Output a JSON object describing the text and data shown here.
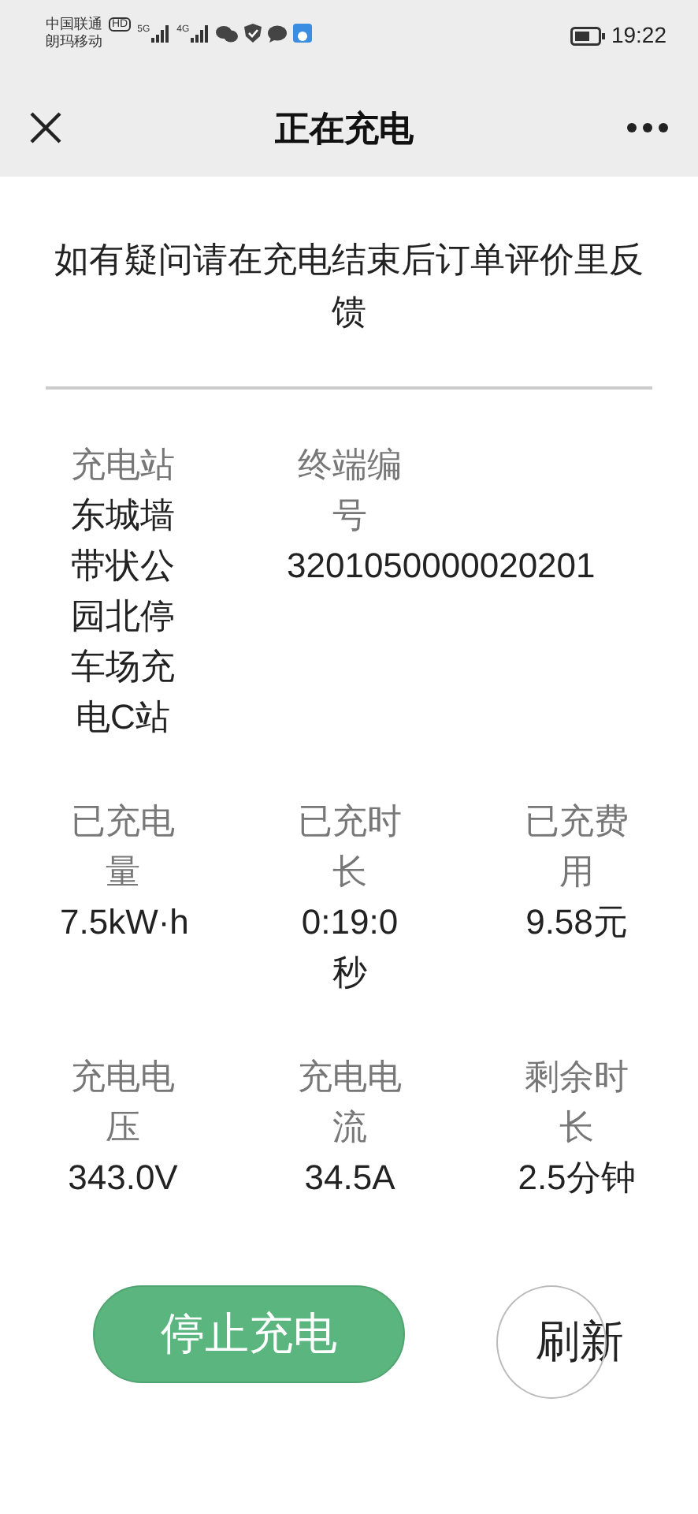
{
  "status_bar": {
    "carrier_1": "中国联通",
    "hd": "HD",
    "carrier_2": "朗玛移动",
    "network_1": "5G",
    "network_2": "4G",
    "time": "19:22"
  },
  "header": {
    "title": "正在充电"
  },
  "notice": "如有疑问请在充电结束后订单评价里反馈",
  "info_rows": [
    [
      {
        "label": "充电站",
        "value": "东城墙带状公园北停车场充电C站"
      },
      {
        "label": "终端编号",
        "value": "3201050000020201"
      }
    ],
    [
      {
        "label": "已充电量",
        "value": "7.5kW·h"
      },
      {
        "label": "已充时长",
        "value": "0:19:0秒"
      },
      {
        "label": "已充费用",
        "value": "9.58元"
      }
    ],
    [
      {
        "label": "充电电压",
        "value": "343.0V"
      },
      {
        "label": "充电电流",
        "value": "34.5A"
      },
      {
        "label": "剩余时长",
        "value": "2.5分钟"
      }
    ]
  ],
  "buttons": [
    {
      "kind": "primary",
      "label": "停止充电"
    },
    {
      "kind": "circle",
      "label": "刷新"
    }
  ]
}
